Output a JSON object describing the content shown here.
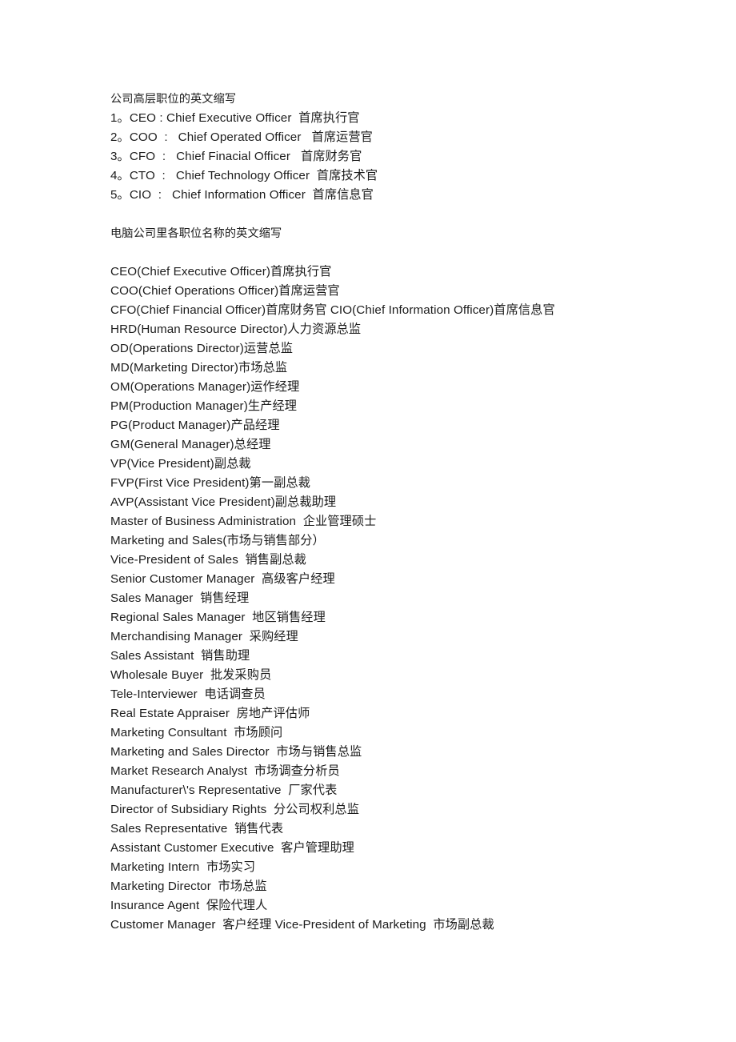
{
  "document": {
    "sections": [
      {
        "name": "executive-abbreviations",
        "heading": "公司高层职位的英文缩写",
        "lines": [
          "1。CEO : Chief Executive Officer  首席执行官",
          "2。COO  :   Chief Operated Officer   首席运营官",
          "3。CFO  :   Chief Finacial Officer   首席财务官",
          "4。CTO  :   Chief Technology Officer  首席技术官",
          "5。CIO  :   Chief Information Officer  首席信息官"
        ]
      },
      {
        "name": "computer-company-titles",
        "heading": "电脑公司里各职位名称的英文缩写",
        "lines": [
          "CEO(Chief Executive Officer)首席执行官",
          "COO(Chief Operations Officer)首席运营官",
          "CFO(Chief Financial Officer)首席财务官 CIO(Chief Information Officer)首席信息官",
          "HRD(Human Resource Director)人力资源总监",
          "OD(Operations Director)运营总监",
          "MD(Marketing Director)市场总监",
          "OM(Operations Manager)运作经理",
          "PM(Production Manager)生产经理",
          "PG(Product Manager)产品经理",
          "GM(General Manager)总经理",
          "VP(Vice President)副总裁",
          "FVP(First Vice President)第一副总裁",
          "AVP(Assistant Vice President)副总裁助理",
          "Master of Business Administration  企业管理硕士",
          "Marketing and Sales(市场与销售部分）",
          "Vice-President of Sales  销售副总裁",
          "Senior Customer Manager  高级客户经理",
          "Sales Manager  销售经理",
          "Regional Sales Manager  地区销售经理",
          "Merchandising Manager  采购经理",
          "Sales Assistant  销售助理",
          "Wholesale Buyer  批发采购员",
          "Tele-Interviewer  电话调查员",
          "Real Estate Appraiser  房地产评估师",
          "Marketing Consultant  市场顾问",
          "Marketing and Sales Director  市场与销售总监",
          "Market Research Analyst  市场调查分析员",
          "Manufacturer\\'s Representative  厂家代表",
          "Director of Subsidiary Rights  分公司权利总监",
          "Sales Representative  销售代表",
          "Assistant Customer Executive  客户管理助理",
          "Marketing Intern  市场实习",
          "Marketing Director  市场总监",
          "Insurance Agent  保险代理人",
          "Customer Manager  客户经理 Vice-President of Marketing  市场副总裁"
        ]
      }
    ]
  }
}
